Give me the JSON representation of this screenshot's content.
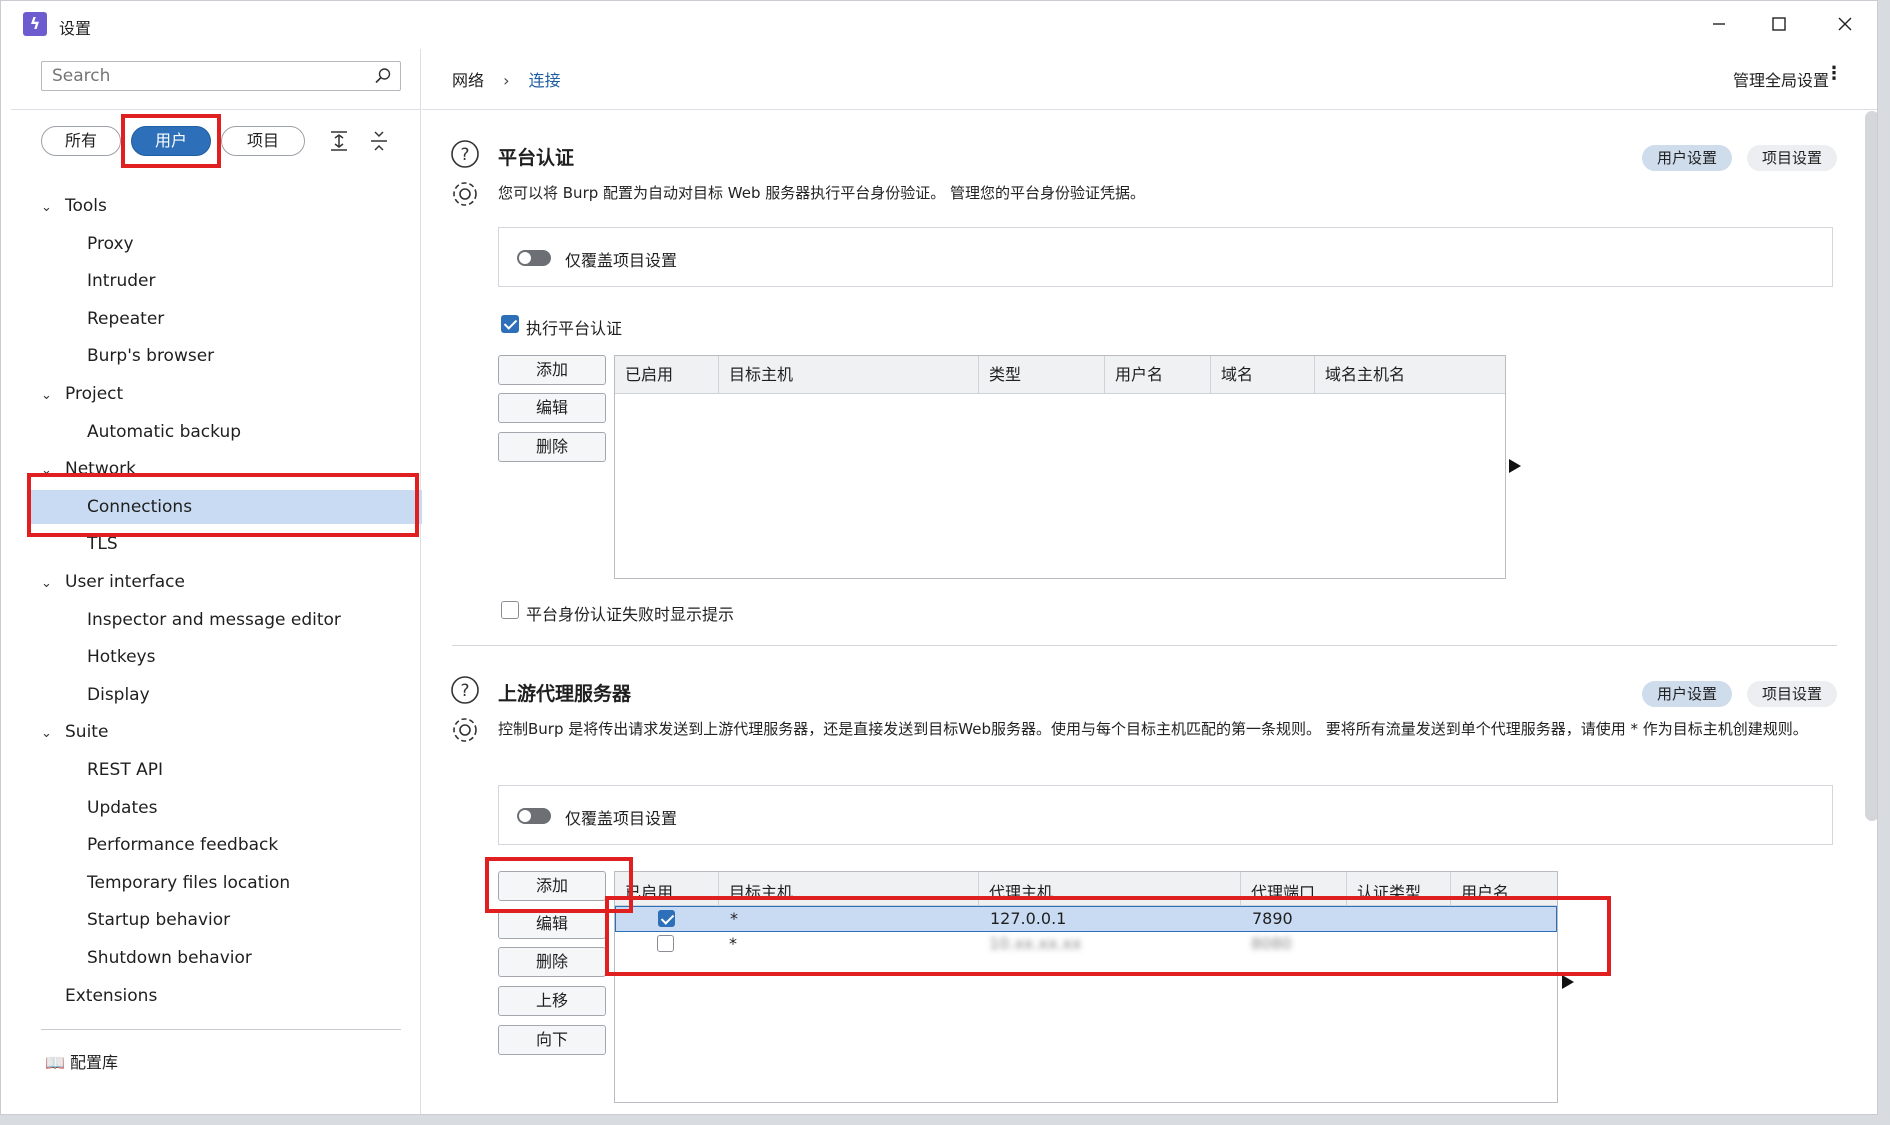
{
  "window": {
    "title": "设置"
  },
  "sidebar": {
    "search_placeholder": "Search",
    "filters": {
      "all": "所有",
      "user": "用户",
      "project": "项目"
    },
    "tree": [
      {
        "type": "cat",
        "label": "Tools"
      },
      {
        "type": "leaf",
        "label": "Proxy"
      },
      {
        "type": "leaf",
        "label": "Intruder"
      },
      {
        "type": "leaf",
        "label": "Repeater"
      },
      {
        "type": "leaf",
        "label": "Burp's browser"
      },
      {
        "type": "cat",
        "label": "Project"
      },
      {
        "type": "leaf",
        "label": "Automatic backup"
      },
      {
        "type": "cat",
        "label": "Network"
      },
      {
        "type": "leaf",
        "label": "Connections",
        "selected": true
      },
      {
        "type": "leaf",
        "label": "TLS"
      },
      {
        "type": "cat",
        "label": "User interface"
      },
      {
        "type": "leaf",
        "label": "Inspector and message editor"
      },
      {
        "type": "leaf",
        "label": "Hotkeys"
      },
      {
        "type": "leaf",
        "label": "Display"
      },
      {
        "type": "cat",
        "label": "Suite"
      },
      {
        "type": "leaf",
        "label": "REST API"
      },
      {
        "type": "leaf",
        "label": "Updates"
      },
      {
        "type": "leaf",
        "label": "Performance feedback"
      },
      {
        "type": "leaf",
        "label": "Temporary files location"
      },
      {
        "type": "leaf",
        "label": "Startup behavior"
      },
      {
        "type": "leaf",
        "label": "Shutdown behavior"
      },
      {
        "type": "cat-nochev",
        "label": "Extensions"
      }
    ],
    "library": "配置库"
  },
  "header": {
    "breadcrumb": [
      "网络",
      "连接"
    ],
    "global_settings": "管理全局设置"
  },
  "platform_auth": {
    "title": "平台认证",
    "description": "您可以将 Burp 配置为自动对目标 Web 服务器执行平台身份验证。 管理您的平台身份验证凭据。",
    "tag_user": "用户设置",
    "tag_project": "项目设置",
    "override_label": "仅覆盖项目设置",
    "enable_label": "执行平台认证",
    "buttons": {
      "add": "添加",
      "edit": "编辑",
      "remove": "删除"
    },
    "columns": [
      "已启用",
      "目标主机",
      "类型",
      "用户名",
      "域名",
      "域名主机名"
    ],
    "prompt_label": "平台身份认证失败时显示提示"
  },
  "upstream_proxy": {
    "title": "上游代理服务器",
    "description": "控制Burp 是将传出请求发送到上游代理服务器，还是直接发送到目标Web服务器。使用与每个目标主机匹配的第一条规则。 要将所有流量发送到单个代理服务器，请使用 * 作为目标主机创建规则。",
    "tag_user": "用户设置",
    "tag_project": "项目设置",
    "override_label": "仅覆盖项目设置",
    "buttons": {
      "add": "添加",
      "edit": "编辑",
      "remove": "删除",
      "up": "上移",
      "down": "向下"
    },
    "columns": [
      "已启用",
      "目标主机",
      "代理主机",
      "代理端口",
      "认证类型",
      "用户名"
    ],
    "rows": [
      {
        "enabled": true,
        "target": "*",
        "host": "127.0.0.1",
        "port": "7890"
      },
      {
        "enabled": false,
        "target": "*",
        "host": "10.xx.xx.xx",
        "port": "8080"
      }
    ]
  }
}
